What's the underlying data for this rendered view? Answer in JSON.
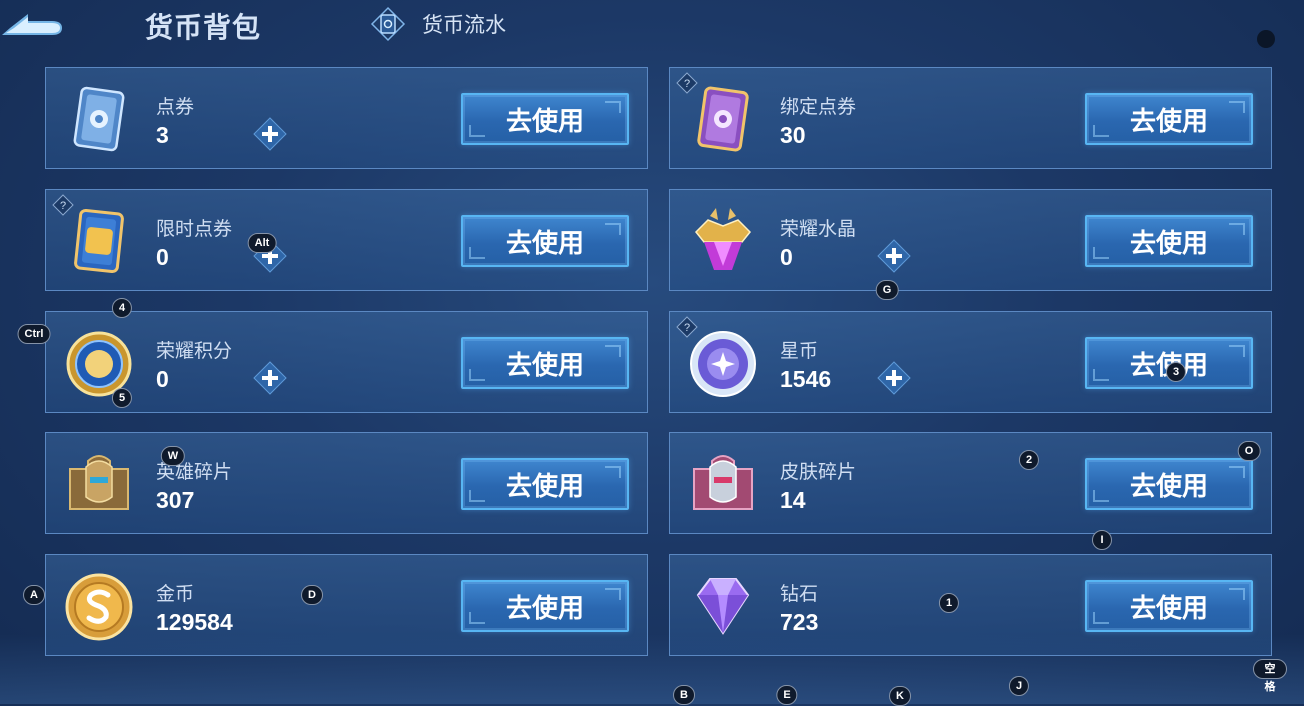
{
  "header": {
    "title": "货币背包",
    "flow_label": "货币流水"
  },
  "currencies": [
    {
      "name": "点券",
      "value": "3",
      "button": "去使用"
    },
    {
      "name": "绑定点券",
      "value": "30",
      "button": "去使用"
    },
    {
      "name": "限时点券",
      "value": "0",
      "button": "去使用"
    },
    {
      "name": "荣耀水晶",
      "value": "0",
      "button": "去使用"
    },
    {
      "name": "荣耀积分",
      "value": "0",
      "button": "去使用"
    },
    {
      "name": "星币",
      "value": "1546",
      "button": "去使用"
    },
    {
      "name": "英雄碎片",
      "value": "307",
      "button": "去使用"
    },
    {
      "name": "皮肤碎片",
      "value": "14",
      "button": "去使用"
    },
    {
      "name": "金币",
      "value": "129584",
      "button": "去使用"
    },
    {
      "name": "钻石",
      "value": "723",
      "button": "去使用"
    }
  ],
  "key_hints": [
    "Ctrl",
    "Alt",
    "4",
    "5",
    "W",
    "A",
    "D",
    "G",
    "3",
    "2",
    "O",
    "I",
    "1",
    "B",
    "E",
    "K",
    "J",
    "空格"
  ]
}
